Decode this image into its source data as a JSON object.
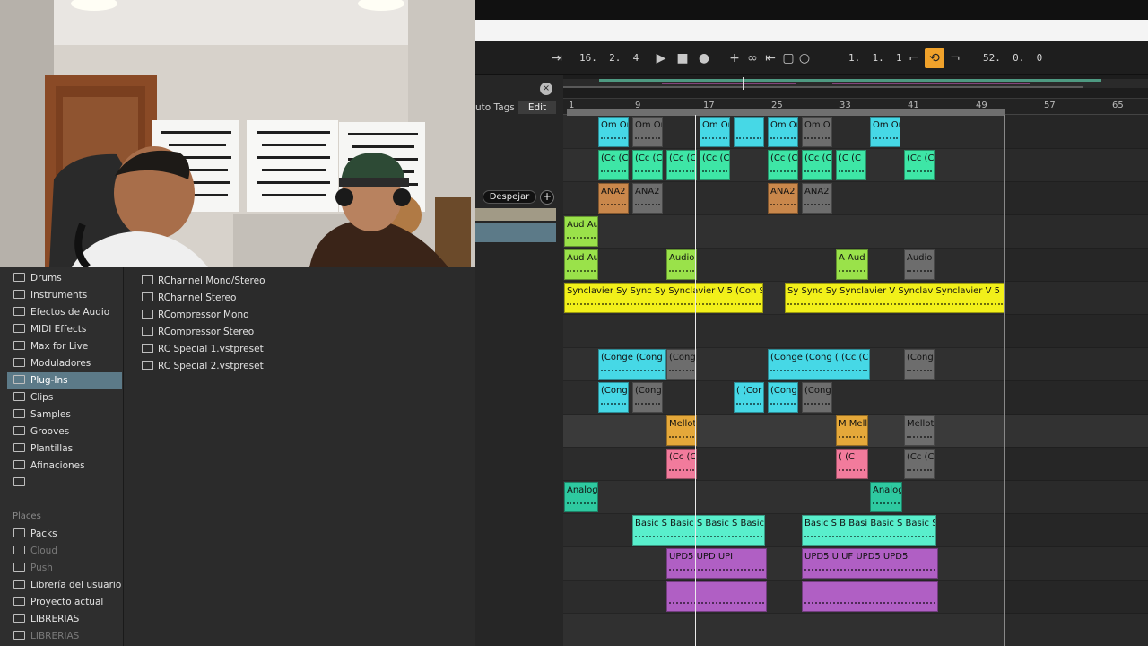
{
  "transport": {
    "arrangement_position": "16.  2.  4",
    "loop_start": "1.  1.  1",
    "loop_length": "52.  0.  0"
  },
  "tags": {
    "auto_tags": "uto Tags",
    "edit": "Edit",
    "clear": "Despejar",
    "add": "+",
    "close": "×"
  },
  "sidebar": {
    "categories": [
      "Drums",
      "Instruments",
      "Efectos de Audio",
      "MIDI Effects",
      "Max for Live",
      "Moduladores",
      "Plug-Ins",
      "Clips",
      "Samples",
      "Grooves",
      "Plantillas",
      "Afinaciones"
    ],
    "selected": "Plug-Ins",
    "places_heading": "Places",
    "places": [
      "Packs",
      "Cloud",
      "Push",
      "Librería del usuario",
      "Proyecto actual",
      "LIBRERIAS",
      "LIBRERIAS"
    ]
  },
  "files": [
    "RChannel Mono/Stereo",
    "RChannel Stereo",
    "RCompressor Mono",
    "RCompressor Stereo",
    "RC Special 1.vstpreset",
    "RC Special 2.vstpreset"
  ],
  "ruler": [
    "1",
    "9",
    "17",
    "25",
    "33",
    "41",
    "49",
    "57",
    "65"
  ],
  "colors": {
    "cyan": "#46d8e6",
    "green": "#3ee6a6",
    "brown": "#c9874b",
    "lime": "#9ae24a",
    "yellow": "#f2f01a",
    "orange": "#e5a83a",
    "pink": "#f27b9c",
    "teal": "#2ec9a0",
    "mint": "#59efcc",
    "purple": "#b05fc4",
    "grey": "#6d6d6d"
  },
  "clips": [
    {
      "lane": 0,
      "color": "cyan",
      "label": "Om Om"
    },
    {
      "lane": 0,
      "color": "grey",
      "label": "Om Om"
    },
    {
      "lane": 0,
      "color": "cyan",
      "label": "Om Om"
    },
    {
      "lane": 0,
      "color": "cyan",
      "label": ""
    },
    {
      "lane": 0,
      "color": "cyan",
      "label": "Om Om"
    },
    {
      "lane": 0,
      "color": "grey",
      "label": "Om Om"
    },
    {
      "lane": 0,
      "color": "cyan",
      "label": "Om Om"
    },
    {
      "lane": 1,
      "color": "green",
      "label": "(Cc (C"
    },
    {
      "lane": 1,
      "color": "green",
      "label": "(Cc (C"
    },
    {
      "lane": 1,
      "color": "green",
      "label": "(Cc (C"
    },
    {
      "lane": 1,
      "color": "green",
      "label": "(Cc (C"
    },
    {
      "lane": 1,
      "color": "green",
      "label": "(Cc (C"
    },
    {
      "lane": 1,
      "color": "green",
      "label": "(Cc (C"
    },
    {
      "lane": 1,
      "color": "green",
      "label": "(C (C"
    },
    {
      "lane": 1,
      "color": "green",
      "label": "(Cc (C"
    },
    {
      "lane": 2,
      "color": "brown",
      "label": "ANA2"
    },
    {
      "lane": 2,
      "color": "grey",
      "label": "ANA2"
    },
    {
      "lane": 2,
      "color": "brown",
      "label": "ANA2"
    },
    {
      "lane": 2,
      "color": "grey",
      "label": "ANA2"
    },
    {
      "lane": 3,
      "color": "lime",
      "label": "Aud Aud"
    },
    {
      "lane": 4,
      "color": "lime",
      "label": "Aud Au"
    },
    {
      "lane": 4,
      "color": "lime",
      "label": "Audio"
    },
    {
      "lane": 4,
      "color": "lime",
      "label": "A Aud"
    },
    {
      "lane": 4,
      "color": "grey",
      "label": "Audio"
    },
    {
      "lane": 5,
      "color": "yellow",
      "label": "Synclavier Sy Sync Sy Synclavier V 5 (Con Sy"
    },
    {
      "lane": 5,
      "color": "yellow",
      "label": "Sy Sync Sy Synclavier V Synclav Synclavier V 5 ("
    },
    {
      "lane": 7,
      "color": "cyan",
      "label": "(Conge (Cong"
    },
    {
      "lane": 7,
      "color": "grey",
      "label": "(Cong"
    },
    {
      "lane": 7,
      "color": "cyan",
      "label": "(Conge (Cong ( (Cc (Cong"
    },
    {
      "lane": 7,
      "color": "grey",
      "label": "(Conge"
    },
    {
      "lane": 8,
      "color": "cyan",
      "label": "(Cong"
    },
    {
      "lane": 8,
      "color": "grey",
      "label": "(Cong"
    },
    {
      "lane": 8,
      "color": "cyan",
      "label": "( (Cor"
    },
    {
      "lane": 8,
      "color": "cyan",
      "label": "(Cong"
    },
    {
      "lane": 8,
      "color": "grey",
      "label": "(Cong"
    },
    {
      "lane": 9,
      "color": "orange",
      "label": "Mellotr"
    },
    {
      "lane": 9,
      "color": "orange",
      "label": "M Mell"
    },
    {
      "lane": 9,
      "color": "grey",
      "label": "Mellotr"
    },
    {
      "lane": 10,
      "color": "pink",
      "label": "(Cc (C"
    },
    {
      "lane": 10,
      "color": "pink",
      "label": "( (C"
    },
    {
      "lane": 10,
      "color": "grey",
      "label": "(Cc (C"
    },
    {
      "lane": 11,
      "color": "teal",
      "label": "Analog"
    },
    {
      "lane": 11,
      "color": "teal",
      "label": "Analog"
    },
    {
      "lane": 12,
      "color": "mint",
      "label": "Basic S Basic S Basic S Basic S"
    },
    {
      "lane": 12,
      "color": "mint",
      "label": "Basic S B Basi Basic S Basic S"
    },
    {
      "lane": 13,
      "color": "purple",
      "label": "UPD5 UPD UPI"
    },
    {
      "lane": 13,
      "color": "purple",
      "label": "UPD5 U UF UPD5 UPD5"
    },
    {
      "lane": 14,
      "color": "purple",
      "label": ""
    },
    {
      "lane": 14,
      "color": "purple",
      "label": ""
    }
  ]
}
